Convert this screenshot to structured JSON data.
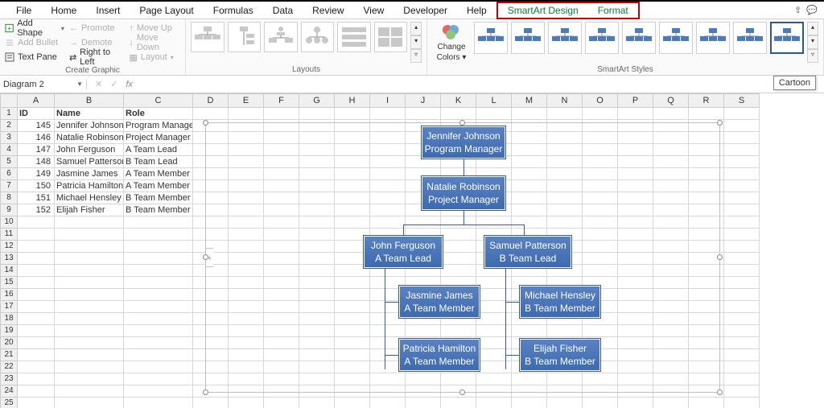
{
  "tabs": {
    "file": "File",
    "home": "Home",
    "insert": "Insert",
    "pagelayout": "Page Layout",
    "formulas": "Formulas",
    "data": "Data",
    "review": "Review",
    "view": "View",
    "developer": "Developer",
    "help": "Help",
    "smartart": "SmartArt Design",
    "format": "Format"
  },
  "ribbon": {
    "create": {
      "label": "Create Graphic",
      "addshape": "Add Shape",
      "addbullet": "Add Bullet",
      "textpane": "Text Pane",
      "promote": "Promote",
      "demote": "Demote",
      "r2l": "Right to Left",
      "moveup": "Move Up",
      "movedown": "Move Down",
      "layout": "Layout"
    },
    "layouts": {
      "label": "Layouts"
    },
    "changecolors": {
      "top": "Change",
      "bottom": "Colors"
    },
    "styles": {
      "label": "SmartArt Styles"
    }
  },
  "namebox": "Diagram 2",
  "fx_label": "fx",
  "tooltip": "Cartoon",
  "columns": [
    "A",
    "B",
    "C",
    "D",
    "E",
    "F",
    "G",
    "H",
    "I",
    "J",
    "K",
    "L",
    "M",
    "N",
    "O",
    "P",
    "Q",
    "R",
    "S"
  ],
  "headerRow": {
    "A": "ID",
    "B": "Name",
    "C": "Role"
  },
  "rows": [
    {
      "A": "145",
      "B": "Jennifer Johnson",
      "C": "Program Manager"
    },
    {
      "A": "146",
      "B": "Natalie Robinson",
      "C": "Project Manager"
    },
    {
      "A": "147",
      "B": "John Ferguson",
      "C": "A Team Lead"
    },
    {
      "A": "148",
      "B": "Samuel Patterson",
      "C": "B Team Lead"
    },
    {
      "A": "149",
      "B": "Jasmine James",
      "C": "A Team Member"
    },
    {
      "A": "150",
      "B": "Patricia Hamilton",
      "C": "A Team Member"
    },
    {
      "A": "151",
      "B": "Michael Hensley",
      "C": "B Team Member"
    },
    {
      "A": "152",
      "B": "Elijah Fisher",
      "C": "B Team Member"
    }
  ],
  "org": {
    "n1": {
      "name": "Jennifer Johnson",
      "role": "Program Manager"
    },
    "n2": {
      "name": "Natalie Robinson",
      "role": "Project Manager"
    },
    "n3": {
      "name": "John Ferguson",
      "role": "A Team Lead"
    },
    "n4": {
      "name": "Samuel Patterson",
      "role": "B Team Lead"
    },
    "n5": {
      "name": "Jasmine James",
      "role": "A Team Member"
    },
    "n6": {
      "name": "Patricia Hamilton",
      "role": "A Team Member"
    },
    "n7": {
      "name": "Michael Hensley",
      "role": "B Team Member"
    },
    "n8": {
      "name": "Elijah Fisher",
      "role": "B Team Member"
    }
  }
}
